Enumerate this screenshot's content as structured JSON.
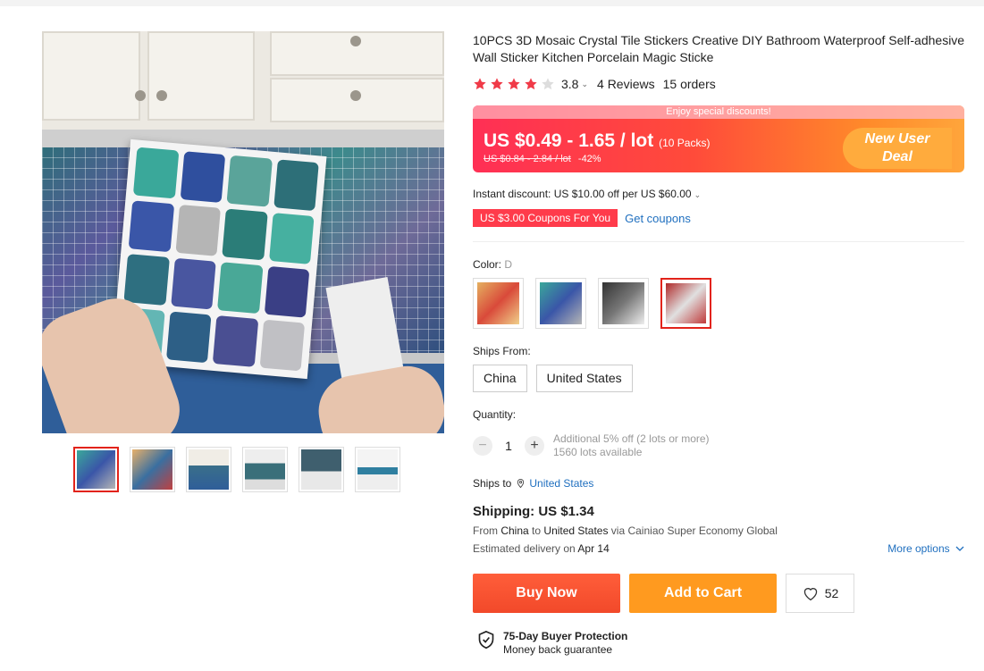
{
  "product": {
    "title": "10PCS 3D Mosaic Crystal Tile Stickers Creative DIY Bathroom Waterproof Self-adhesive Wall Sticker Kitchen Porcelain Magic Sticke",
    "rating": "3.8",
    "stars_filled": 4,
    "stars_total": 5,
    "reviews": "4 Reviews",
    "orders": "15 orders"
  },
  "promo": {
    "banner": "Enjoy special discounts!",
    "price": "US $0.49 - 1.65 / lot",
    "pack": "(10 Packs)",
    "original_price": "US $0.84 - 2.84 / lot",
    "discount": "-42%",
    "badge_line1": "New User",
    "badge_line2": "Deal"
  },
  "discount": {
    "instant": "Instant discount: US $10.00 off per US $60.00",
    "coupon": "US $3.00 Coupons For You",
    "get_coupons": "Get coupons"
  },
  "color": {
    "label": "Color:",
    "selected": "D"
  },
  "ships_from": {
    "label": "Ships From:",
    "options": [
      "China",
      "United States"
    ]
  },
  "quantity": {
    "label": "Quantity:",
    "minus": "−",
    "plus": "+",
    "value": "1",
    "note1": "Additional 5% off (2 lots or more)",
    "note2": "1560 lots available"
  },
  "shipping": {
    "ships_to_label": "Ships to",
    "ships_to_value": "United States",
    "cost": "Shipping: US $1.34",
    "from_prefix": "From",
    "from_country": "China",
    "to_word": "to",
    "to_country": "United States",
    "via": "via Cainiao Super Economy Global",
    "est_prefix": "Estimated delivery on",
    "est_date": "Apr 14",
    "more": "More options"
  },
  "actions": {
    "buy": "Buy Now",
    "cart": "Add to Cart",
    "wishlist_count": "52"
  },
  "protection": {
    "title": "75-Day Buyer Protection",
    "subtitle": "Money back guarantee"
  },
  "colors": {
    "accent": "#e2231a",
    "link": "#1f6fbf",
    "buy": "#ff4e2b",
    "cart": "#ff9a1f"
  }
}
